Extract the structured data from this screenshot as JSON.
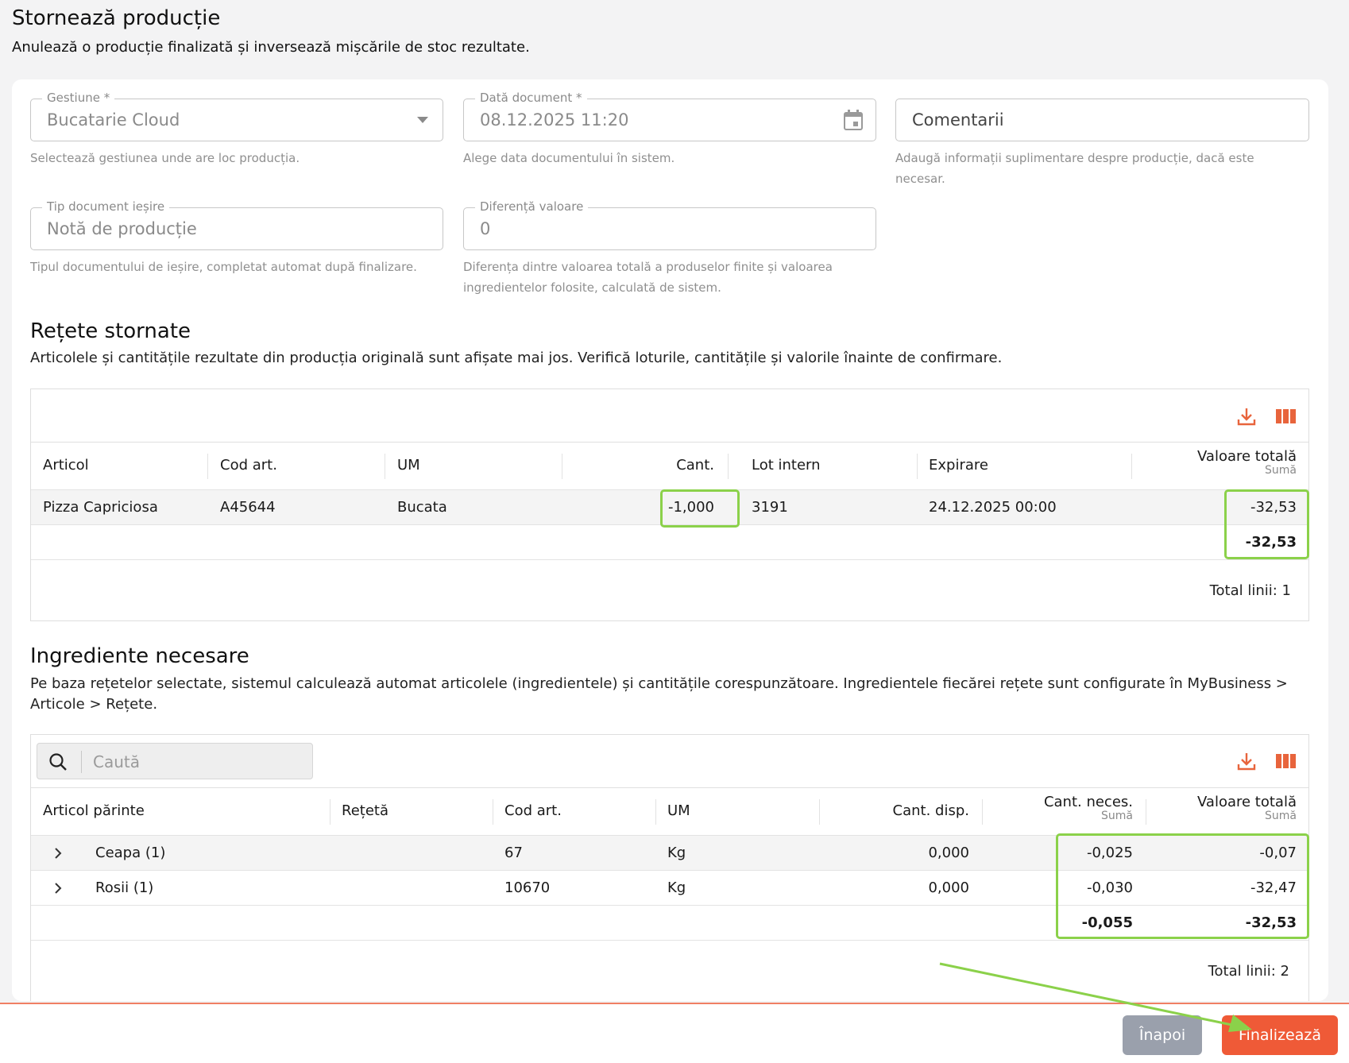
{
  "page": {
    "title": "Stornează producție",
    "subtitle": "Anulează o producție finalizată și inversează mișcările de stoc rezultate."
  },
  "form": {
    "gestiune": {
      "label": "Gestiune *",
      "value": "Bucatarie Cloud",
      "hint": "Selectează gestiunea unde are loc producția."
    },
    "data_document": {
      "label": "Dată document *",
      "value": "08.12.2025 11:20",
      "hint": "Alege data documentului în sistem."
    },
    "comentarii": {
      "placeholder": "Comentarii",
      "hint": "Adaugă informații suplimentare despre producție, dacă este necesar."
    },
    "tip_document": {
      "label": "Tip document ieșire",
      "value": "Notă de producție",
      "hint": "Tipul documentului de ieșire, completat automat după finalizare."
    },
    "diferenta": {
      "label": "Diferență valoare",
      "value": "0",
      "hint": "Diferența dintre valoarea totală a produselor finite și valoarea ingredientelor folosite, calculată de sistem."
    }
  },
  "recipes": {
    "title": "Rețete stornate",
    "description": "Articolele și cantitățile rezultate din producția originală sunt afișate mai jos. Verifică loturile, cantitățile și valorile înainte de confirmare.",
    "columns": {
      "articol": "Articol",
      "cod": "Cod art.",
      "um": "UM",
      "cant": "Cant.",
      "lot": "Lot intern",
      "expirare": "Expirare",
      "valoare": "Valoare totală",
      "valoare_sub": "Sumă"
    },
    "rows": [
      {
        "articol": "Pizza Capriciosa",
        "cod": "A45644",
        "um": "Bucata",
        "cant": "-1,000",
        "lot": "3191",
        "expirare": "24.12.2025 00:00",
        "valoare": "-32,53"
      }
    ],
    "total_valoare": "-32,53",
    "total_lines": "Total linii: 1"
  },
  "ingredients": {
    "title": "Ingrediente necesare",
    "description": "Pe baza rețetelor selectate, sistemul calculează automat articolele (ingredientele) și cantitățile corespunzătoare. Ingredientele fiecărei rețete sunt configurate în MyBusiness > Articole > Rețete.",
    "search_placeholder": "Caută",
    "columns": {
      "parinte": "Articol părinte",
      "reteta": "Rețetă",
      "cod": "Cod art.",
      "um": "UM",
      "disp": "Cant. disp.",
      "neces": "Cant. neces.",
      "neces_sub": "Sumă",
      "valoare": "Valoare totală",
      "valoare_sub": "Sumă"
    },
    "rows": [
      {
        "parinte": "Ceapa (1)",
        "cod": "67",
        "um": "Kg",
        "disp": "0,000",
        "neces": "-0,025",
        "valoare": "-0,07"
      },
      {
        "parinte": "Rosii (1)",
        "cod": "10670",
        "um": "Kg",
        "disp": "0,000",
        "neces": "-0,030",
        "valoare": "-32,47"
      }
    ],
    "total_neces": "-0,055",
    "total_valoare": "-32,53",
    "total_lines": "Total linii: 2"
  },
  "actions": {
    "back": "Înapoi",
    "finish": "Finalizează"
  },
  "colors": {
    "accent": "#ef5a37",
    "icon": "#e8643c",
    "highlight": "#8bd14a",
    "back_button": "#9aa0ac"
  }
}
